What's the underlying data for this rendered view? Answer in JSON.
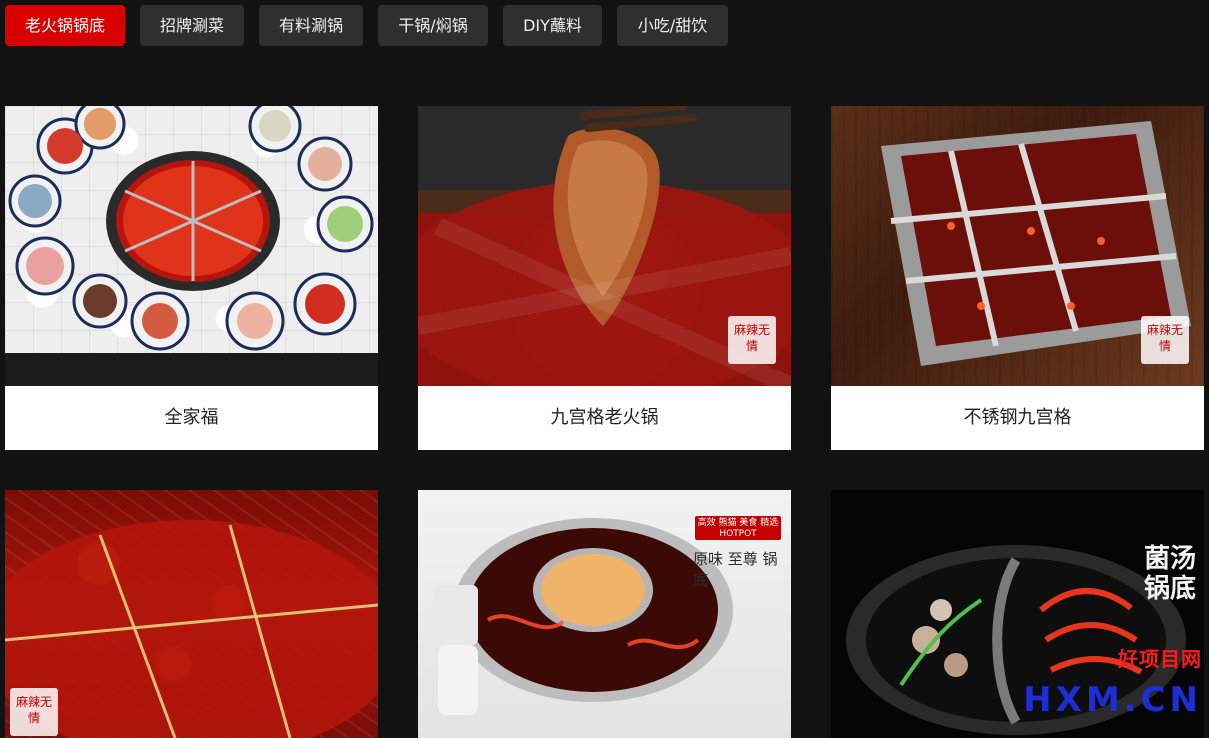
{
  "tabs": [
    {
      "label": "老火锅锅底",
      "active": true
    },
    {
      "label": "招牌涮菜",
      "active": false
    },
    {
      "label": "有料涮锅",
      "active": false
    },
    {
      "label": "干锅/焖锅",
      "active": false
    },
    {
      "label": "DIY蘸料",
      "active": false
    },
    {
      "label": "小吃/甜饮",
      "active": false
    }
  ],
  "cards": [
    {
      "title": "全家福"
    },
    {
      "title": "九宫格老火锅"
    },
    {
      "title": "不锈钢九宫格"
    },
    {
      "title": ""
    },
    {
      "title": ""
    },
    {
      "title": ""
    }
  ],
  "overlays": {
    "brand_stamp_text": "麻辣无情",
    "hotpot_badge_line1": "高效 熊猫 美食 精选",
    "hotpot_badge_line2": "HOTPOT",
    "hotpot_badge_line3": "原味 至尊 锅底",
    "soup_title": "菌汤锅底"
  },
  "watermark": {
    "cn": "好项目网",
    "en": "HXM.CN"
  }
}
